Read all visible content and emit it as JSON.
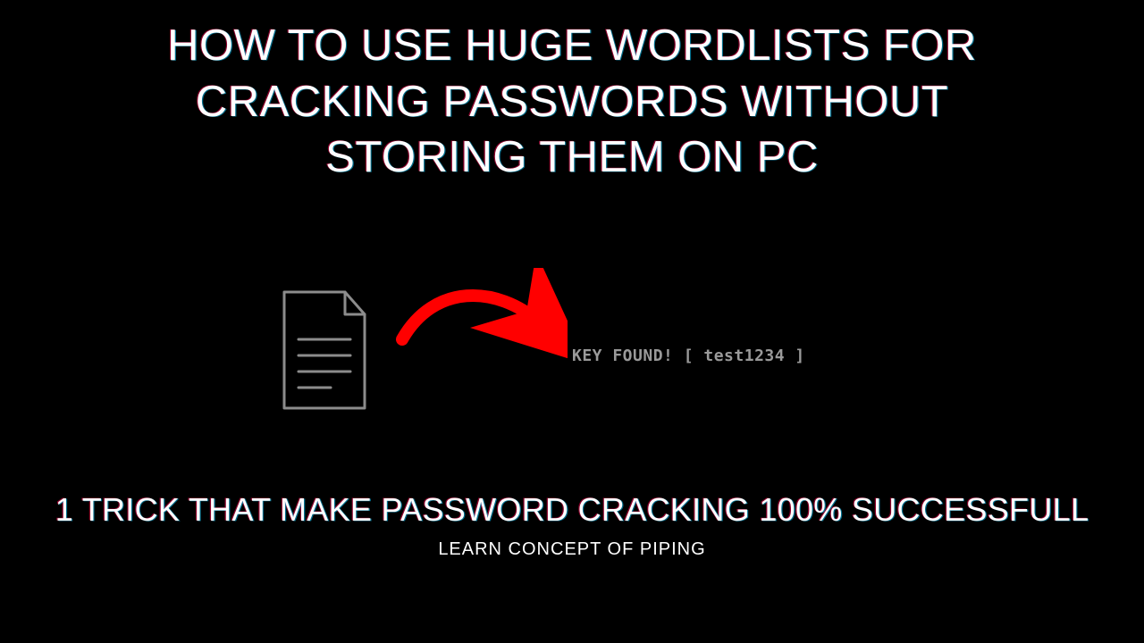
{
  "title": {
    "line1": "HOW TO USE HUGE WORDLISTS FOR",
    "line2": "CRACKING PASSWORDS WITHOUT",
    "line3": "STORING THEM ON PC"
  },
  "terminal_output": "KEY FOUND! [ test1234 ]",
  "subtitle": "1 TRICK THAT MAKE PASSWORD CRACKING 100%  SUCCESSFULL",
  "footer": "LEARN CONCEPT OF PIPING",
  "colors": {
    "arrow": "#ff0000",
    "file_stroke": "#8c8c8c"
  }
}
